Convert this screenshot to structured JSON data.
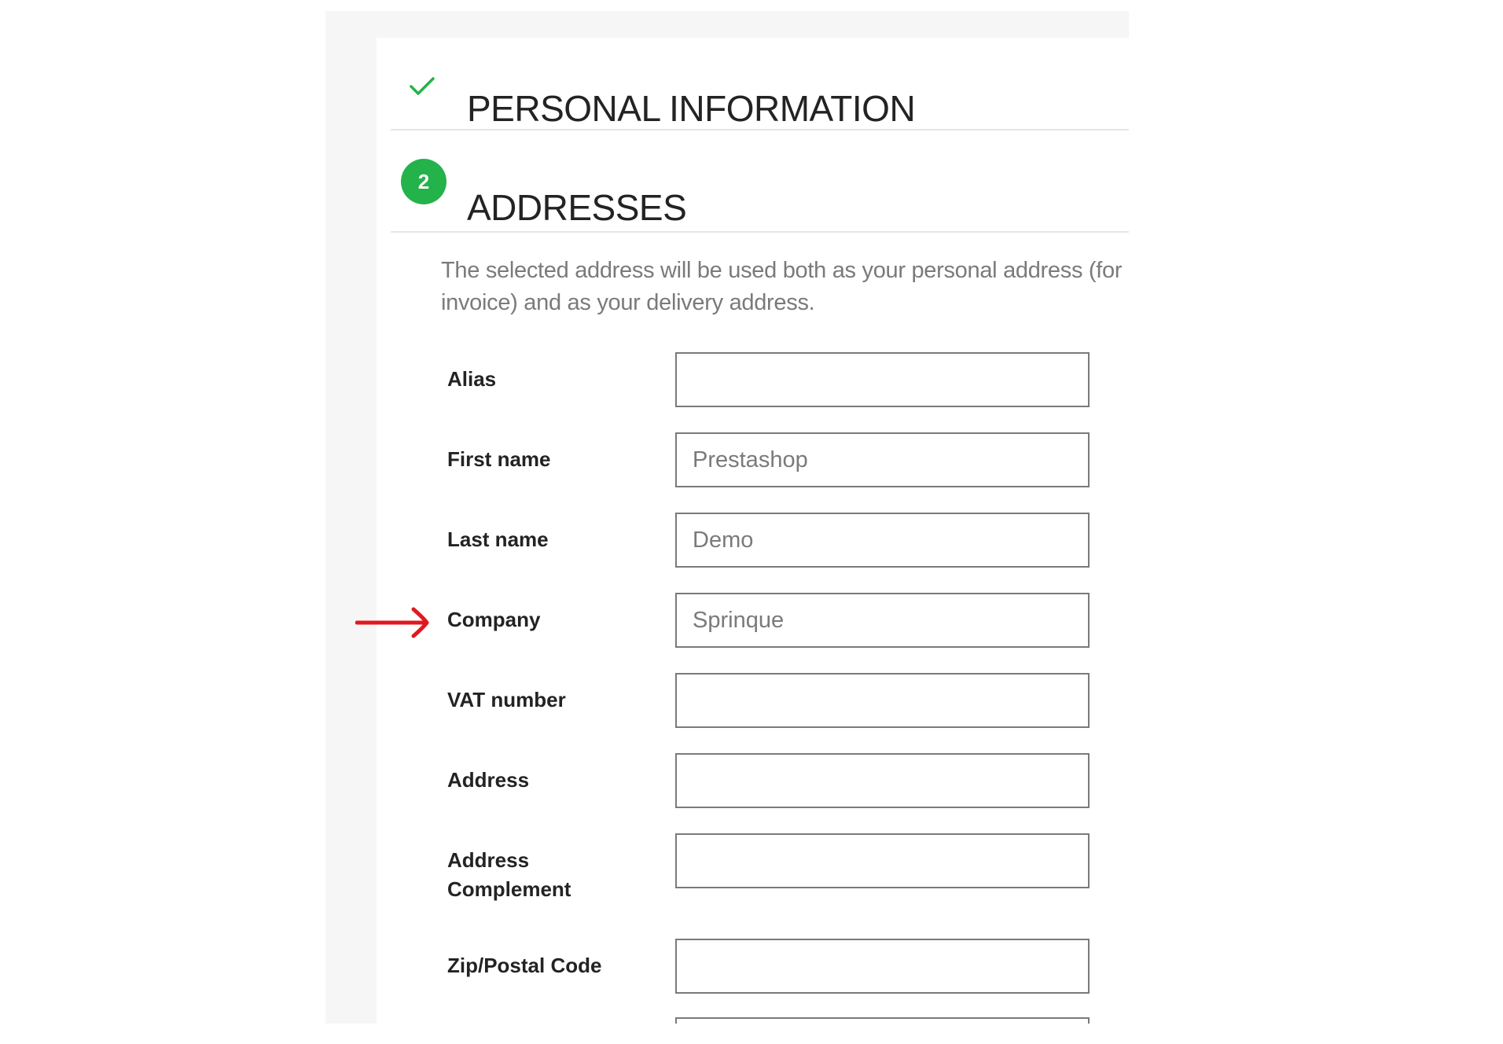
{
  "steps": [
    {
      "title": "PERSONAL INFORMATION",
      "state": "completed",
      "icon": "check-icon"
    },
    {
      "number": "2",
      "title": "ADDRESSES",
      "state": "current"
    }
  ],
  "address_help": "The selected address will be used both as your personal address (for invoice) and as your delivery address.",
  "form": {
    "alias": {
      "label": "Alias",
      "value": ""
    },
    "firstname": {
      "label": "First name",
      "value": "Prestashop"
    },
    "lastname": {
      "label": "Last name",
      "value": "Demo"
    },
    "company": {
      "label": "Company",
      "value": "Sprinque"
    },
    "vat_number": {
      "label": "VAT number",
      "value": ""
    },
    "address": {
      "label": "Address",
      "value": ""
    },
    "address_complement": {
      "label": "Address Complement",
      "value": ""
    },
    "postcode": {
      "label": "Zip/Postal Code",
      "value": ""
    }
  },
  "colors": {
    "accent_green": "#24b24b",
    "annotation_arrow": "#e0191f",
    "panel_background": "#f6f6f6"
  }
}
